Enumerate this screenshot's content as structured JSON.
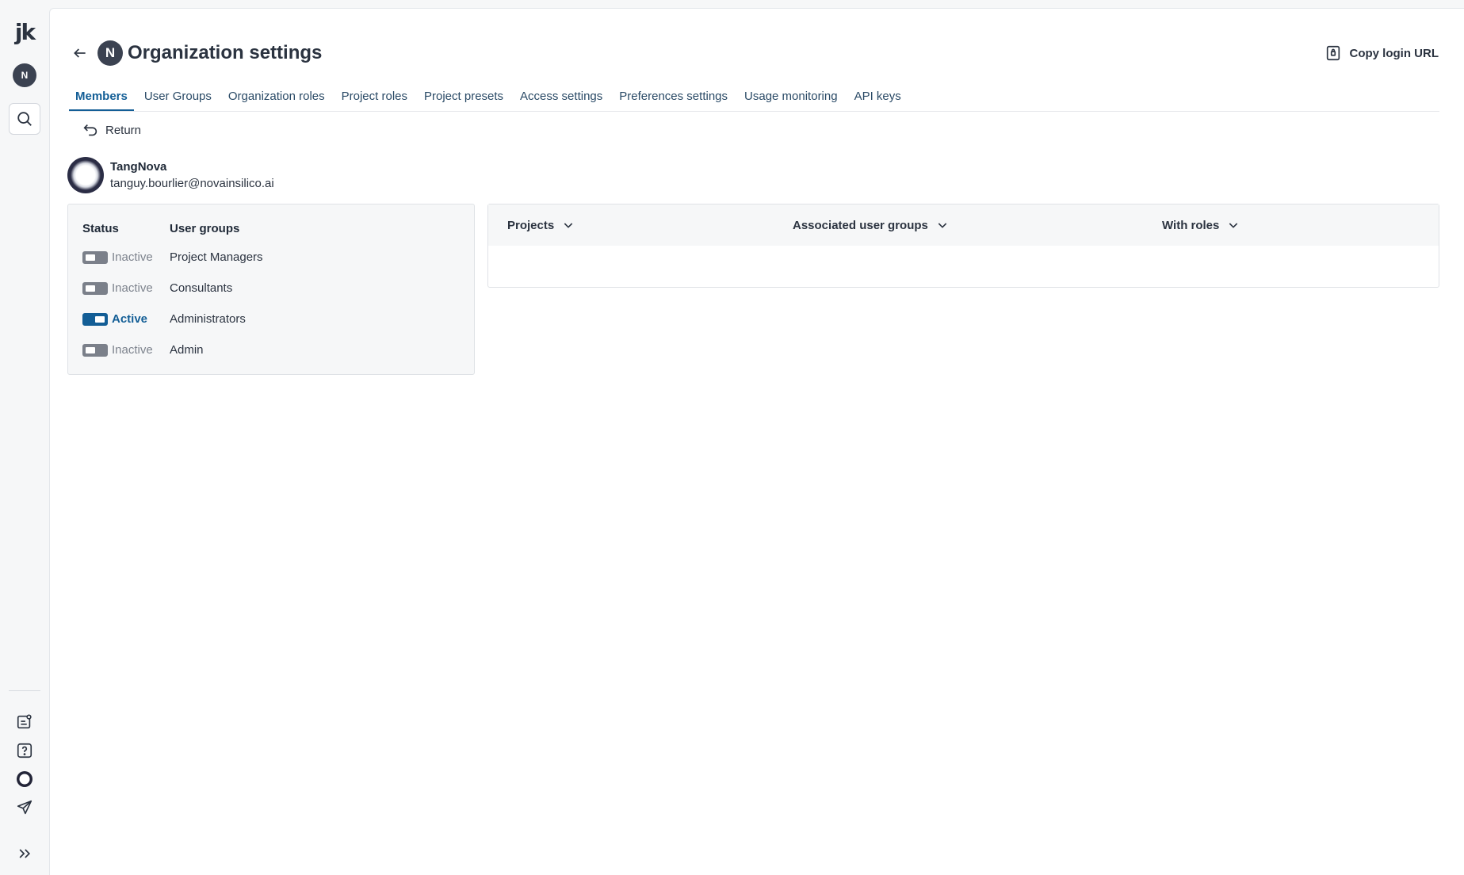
{
  "rail": {
    "logo": "jk",
    "org_initial": "N"
  },
  "header": {
    "org_initial": "N",
    "title": "Organization settings",
    "copy_login_label": "Copy login URL"
  },
  "tabs": [
    {
      "label": "Members",
      "active": true
    },
    {
      "label": "User Groups"
    },
    {
      "label": "Organization roles"
    },
    {
      "label": "Project roles"
    },
    {
      "label": "Project presets"
    },
    {
      "label": "Access settings"
    },
    {
      "label": "Preferences settings"
    },
    {
      "label": "Usage monitoring"
    },
    {
      "label": "API keys"
    }
  ],
  "return_label": "Return",
  "user": {
    "name": "TangNova",
    "email": "tanguy.bourlier@novainsilico.ai"
  },
  "groups": {
    "status_header": "Status",
    "groups_header": "User groups",
    "rows": [
      {
        "status": "Inactive",
        "active": false,
        "name": "Project Managers"
      },
      {
        "status": "Inactive",
        "active": false,
        "name": "Consultants"
      },
      {
        "status": "Active",
        "active": true,
        "name": "Administrators"
      },
      {
        "status": "Inactive",
        "active": false,
        "name": "Admin"
      }
    ]
  },
  "projects_table": {
    "col_projects": "Projects",
    "col_user_groups": "Associated user groups",
    "col_roles": "With roles"
  },
  "colors": {
    "accent": "#135e96",
    "inactive": "#7b808a",
    "avatar_bg": "#3b4251"
  }
}
